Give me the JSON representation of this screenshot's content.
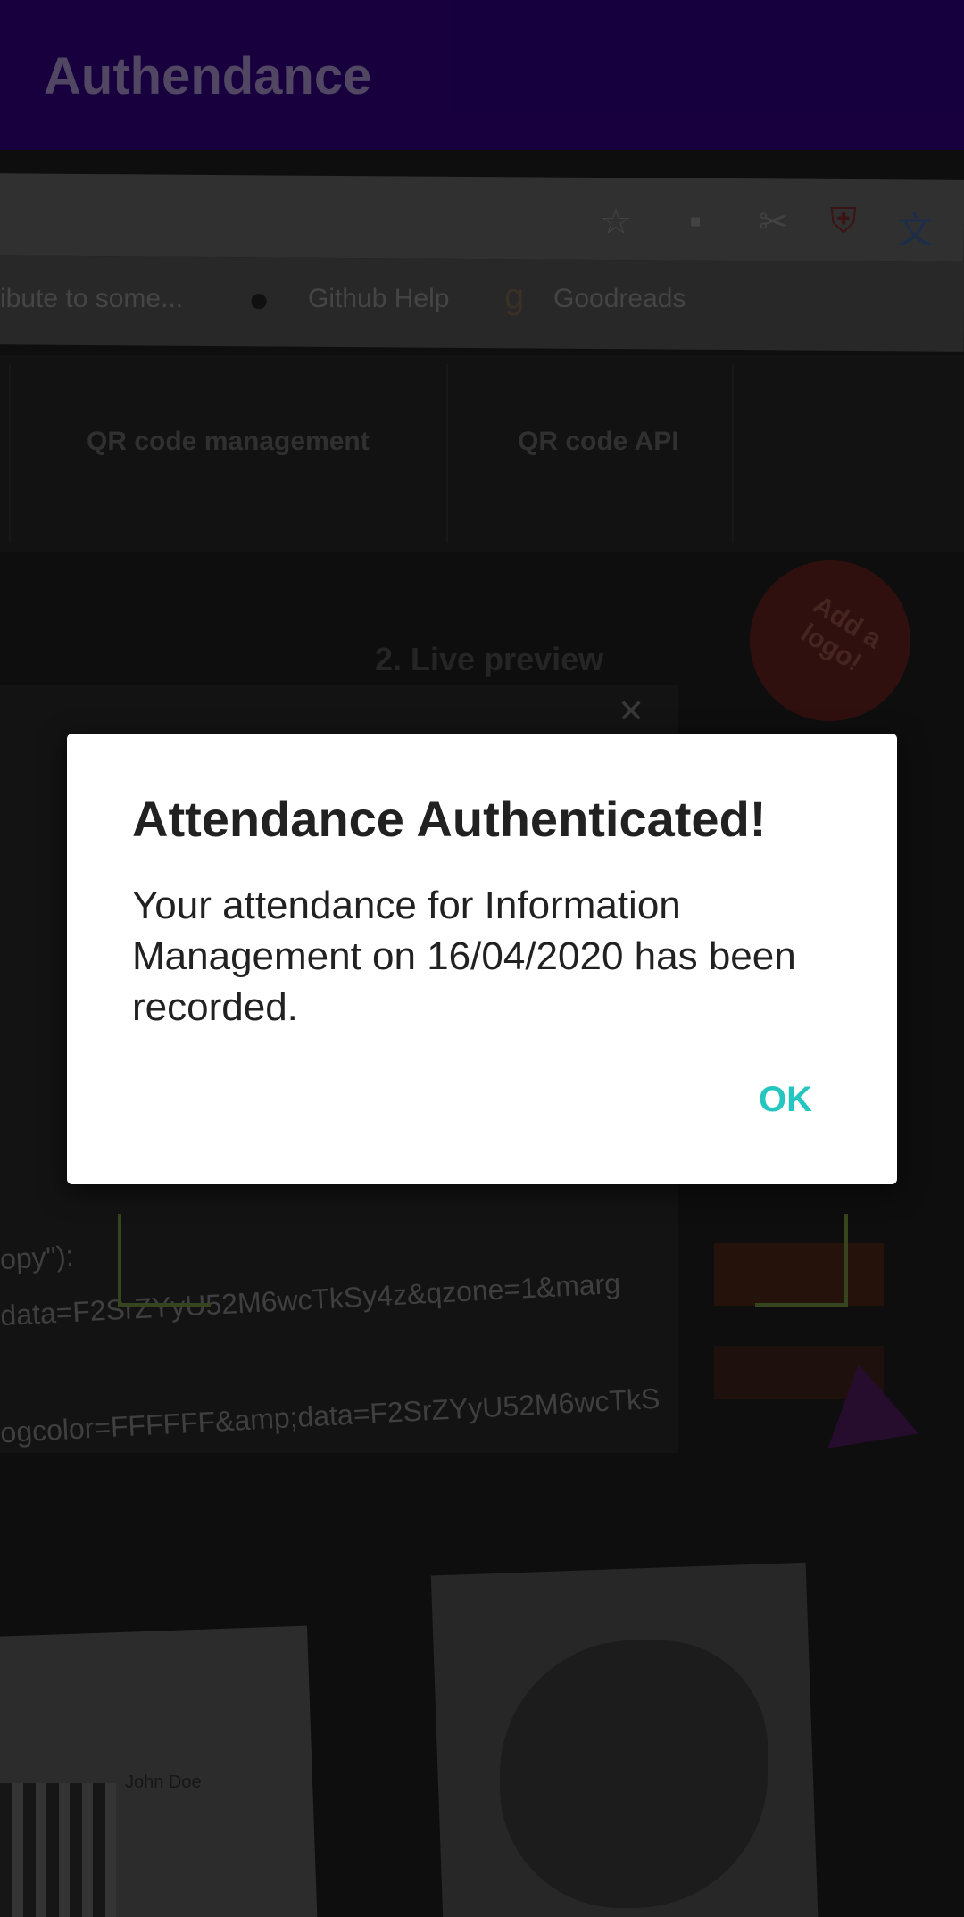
{
  "app_bar": {
    "title": "Authendance"
  },
  "camera_feed": {
    "bookmarks": [
      "ibute to some...",
      "Github Help",
      "Goodreads"
    ],
    "nav_items": [
      "QR code management",
      "QR code API"
    ],
    "badge": "Add a logo!",
    "preview_heading": "2. Live preview",
    "code_lines": [
      "opy\"):",
      "data=F2SrZYyU52M6wcTkSy4z&qzone=1&marg",
      "ogcolor=FFFFFF&amp;data=F2SrZYyU52M6wcTkS"
    ],
    "card_name": "John Doe"
  },
  "dialog": {
    "title": "Attendance Authenticated!",
    "message": "Your attendance for Information Management on 16/04/2020 has been recorded.",
    "ok_label": "OK"
  },
  "colors": {
    "app_bar": "#24005f",
    "app_bar_title": "#7d6d98",
    "dialog_button": "#26c6c0",
    "scan_frame": "#536a2d"
  }
}
